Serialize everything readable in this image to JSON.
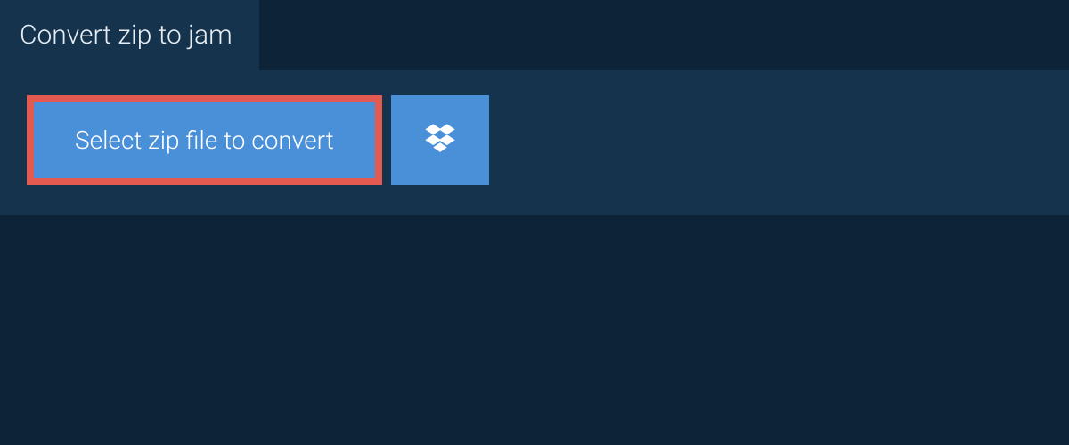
{
  "header": {
    "title": "Convert zip to jam"
  },
  "actions": {
    "select_file_label": "Select zip file to convert"
  }
}
